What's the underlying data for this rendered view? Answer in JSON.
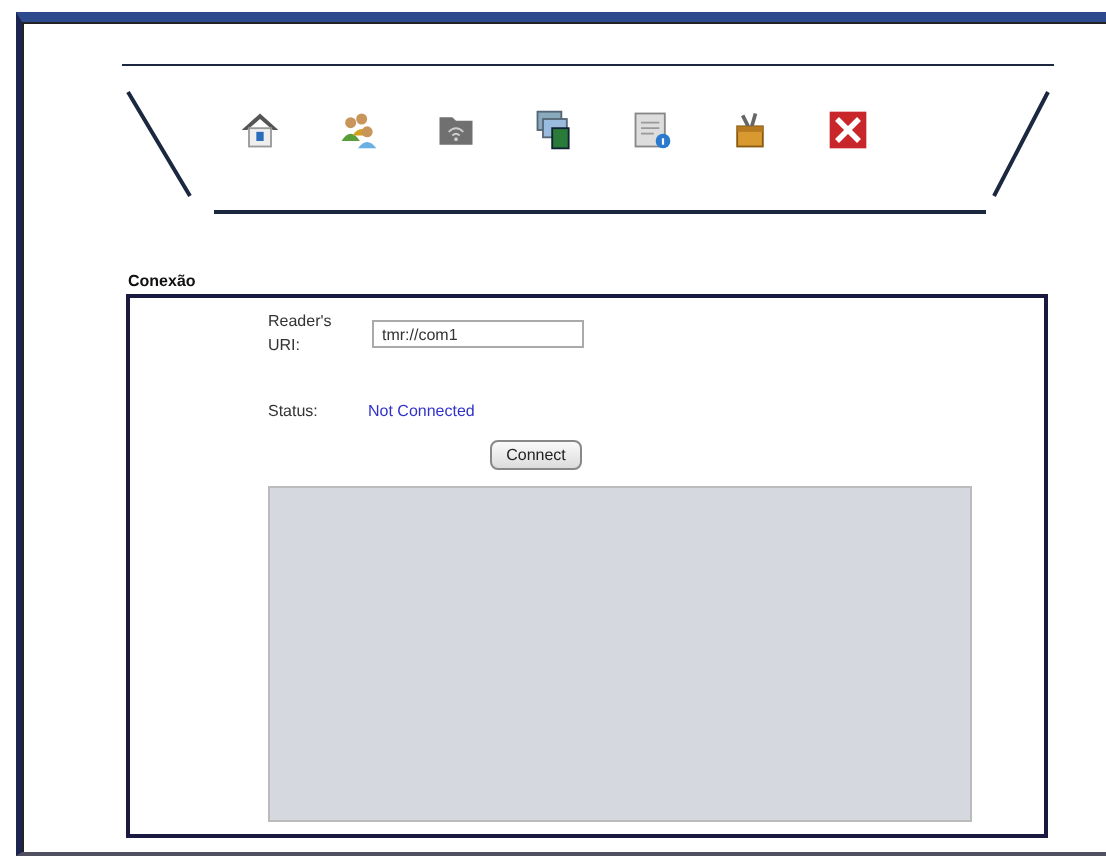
{
  "section": {
    "title": "Conexão"
  },
  "form": {
    "uri_label": "Reader's URI:",
    "uri_value": "tmr://com1",
    "status_label": "Status:",
    "status_value": "Not Connected"
  },
  "buttons": [
    {
      "label": "Connect"
    }
  ]
}
